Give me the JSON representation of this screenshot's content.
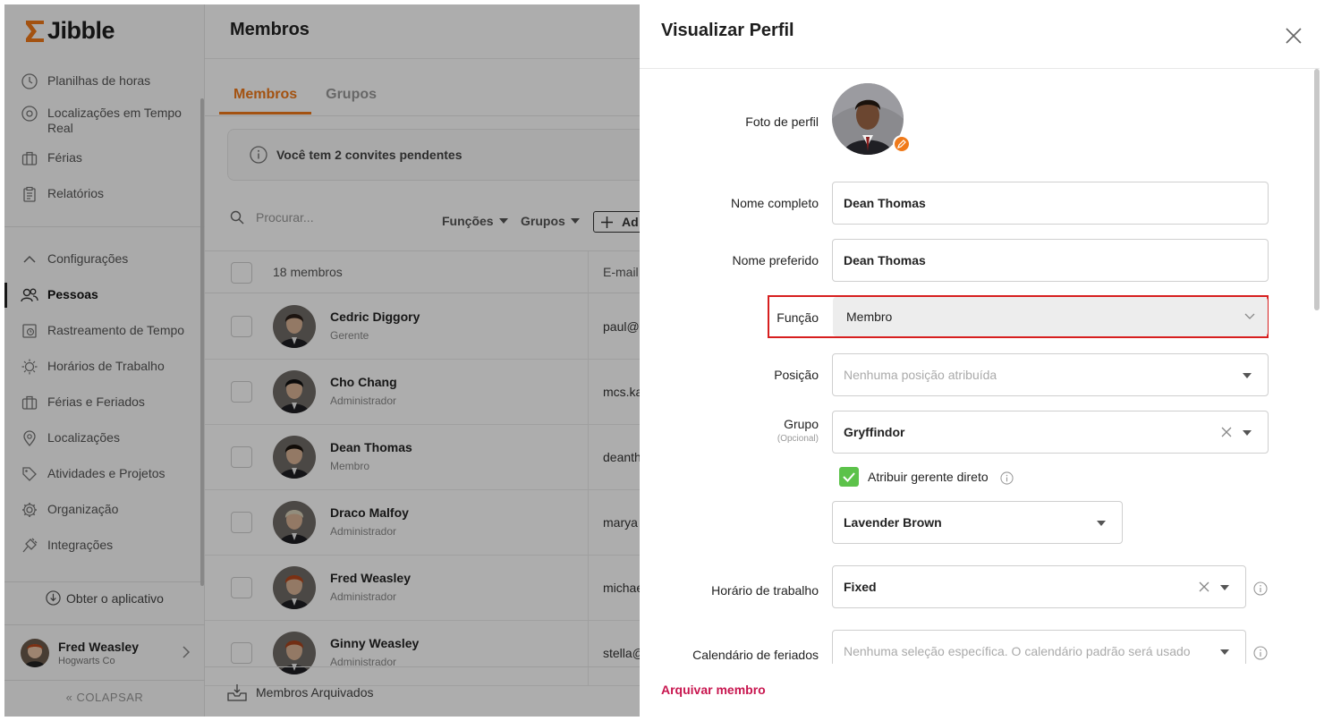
{
  "app": {
    "name": "Jibble",
    "accent": "#f07a1a"
  },
  "sidebar": {
    "items": [
      {
        "label": "Planilhas de horas",
        "icon": "clock-icon"
      },
      {
        "label": "Localizações em Tempo Real",
        "icon": "location-pin-icon"
      },
      {
        "label": "Férias",
        "icon": "briefcase-icon"
      },
      {
        "label": "Relatórios",
        "icon": "clipboard-icon"
      }
    ],
    "settings_label": "Configurações",
    "settings_items": [
      {
        "label": "Pessoas",
        "icon": "people-icon",
        "active": true
      },
      {
        "label": "Rastreamento de Tempo",
        "icon": "time-tracking-icon"
      },
      {
        "label": "Horários de Trabalho",
        "icon": "sun-clock-icon"
      },
      {
        "label": "Férias e Feriados",
        "icon": "briefcase-icon"
      },
      {
        "label": "Localizações",
        "icon": "location-pin-icon"
      },
      {
        "label": "Atividades e Projetos",
        "icon": "tag-icon"
      },
      {
        "label": "Organização",
        "icon": "gear-icon"
      },
      {
        "label": "Integrações",
        "icon": "plug-icon"
      }
    ],
    "get_app": "Obter o aplicativo",
    "user": {
      "name": "Fred Weasley",
      "company": "Hogwarts Co"
    },
    "collapse": "COLAPSAR"
  },
  "main": {
    "title": "Membros",
    "tabs": [
      "Membros",
      "Grupos"
    ],
    "notice": "Você tem 2 convites pendentes",
    "search_placeholder": "Procurar...",
    "filters": [
      "Funções",
      "Grupos"
    ],
    "add_label": "Ad",
    "count_label": "18 membros",
    "email_header": "E-mail",
    "members": [
      {
        "name": "Cedric Diggory",
        "role": "Gerente",
        "email": "paul@",
        "hair": "#2a1e18"
      },
      {
        "name": "Cho Chang",
        "role": "Administrador",
        "email": "mcs.ka",
        "hair": "#111"
      },
      {
        "name": "Dean Thomas",
        "role": "Membro",
        "email": "deanth",
        "hair": "#1a120c"
      },
      {
        "name": "Draco Malfoy",
        "role": "Administrador",
        "email": "marya",
        "hair": "#d8d0b8"
      },
      {
        "name": "Fred Weasley",
        "role": "Administrador",
        "email": "michae",
        "hair": "#b5481c"
      },
      {
        "name": "Ginny Weasley",
        "role": "Administrador",
        "email": "stella@",
        "hair": "#a8441e"
      }
    ],
    "archived": "Membros Arquivados"
  },
  "panel": {
    "title": "Visualizar Perfil",
    "photo_label": "Foto de perfil",
    "full_name_label": "Nome completo",
    "full_name": "Dean Thomas",
    "preferred_name_label": "Nome preferido",
    "preferred_name": "Dean Thomas",
    "role_label": "Função",
    "role": "Membro",
    "position_label": "Posição",
    "position_placeholder": "Nenhuma posição atribuída",
    "group_label": "Grupo",
    "group_optional": "(Opcional)",
    "group": "Gryffindor",
    "assign_manager_label": "Atribuir gerente direto",
    "manager": "Lavender Brown",
    "schedule_label": "Horário de trabalho",
    "schedule": "Fixed",
    "holiday_label": "Calendário de feriados",
    "holiday_placeholder": "Nenhuma seleção específica. O calendário padrão será usado",
    "archive_link": "Arquivar membro"
  }
}
